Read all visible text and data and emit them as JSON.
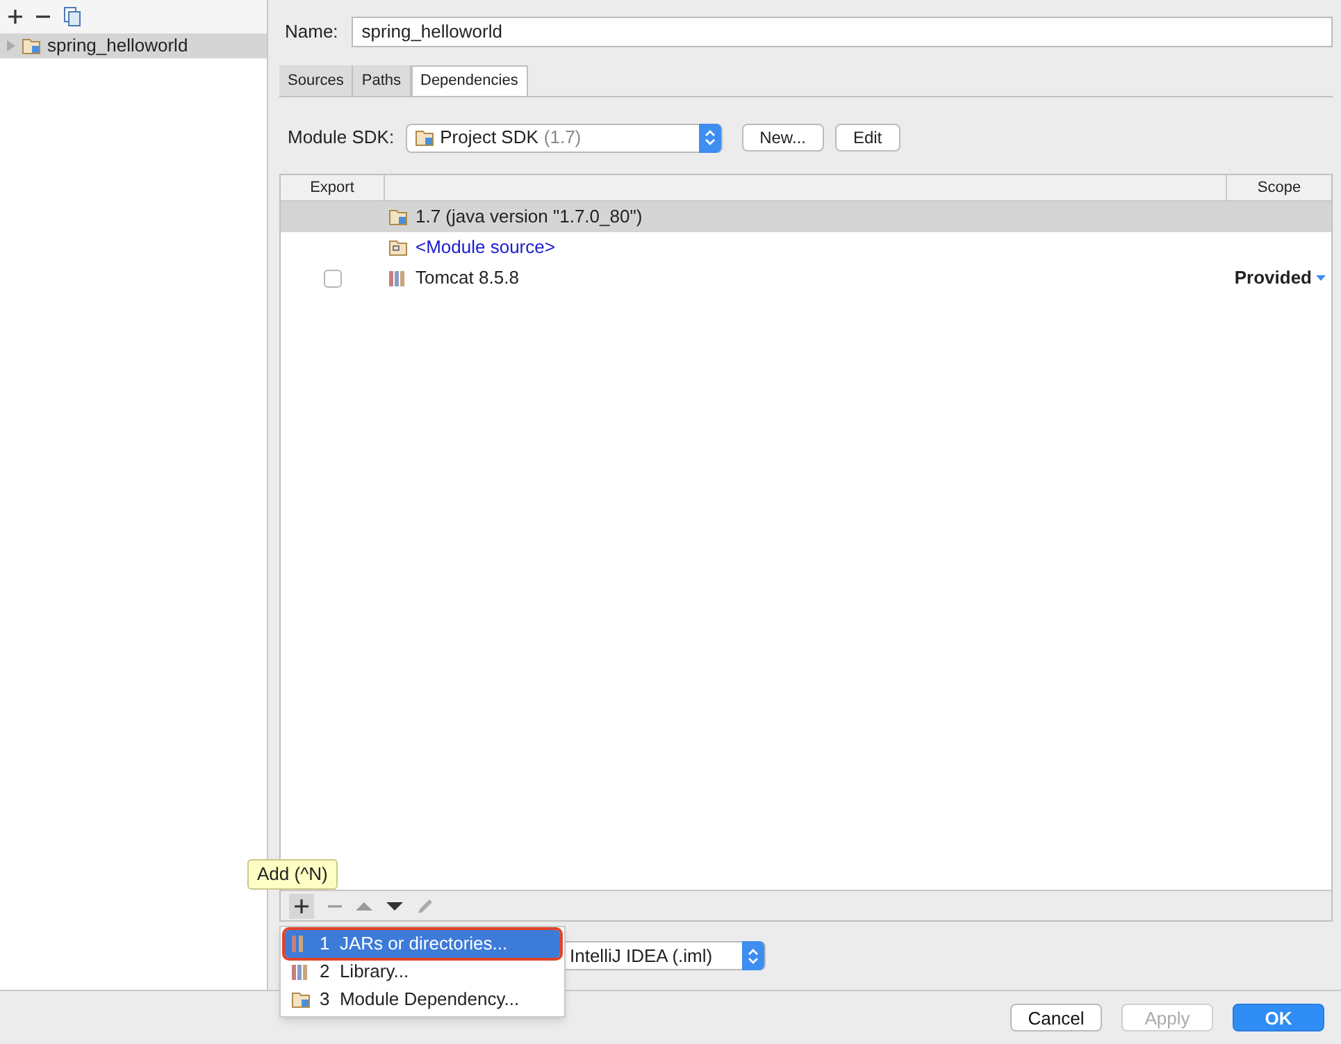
{
  "sidebar": {
    "tree": [
      {
        "label": "spring_helloworld",
        "selected": true,
        "expanded": false
      }
    ]
  },
  "name_field": {
    "label": "Name:",
    "value": "spring_helloworld"
  },
  "tabs": [
    {
      "label": "Sources",
      "selected": false
    },
    {
      "label": "Paths",
      "selected": false
    },
    {
      "label": "Dependencies",
      "selected": true
    }
  ],
  "module_sdk": {
    "label": "Module SDK:",
    "value": "Project SDK",
    "version": "(1.7)",
    "buttons": [
      "New...",
      "Edit"
    ]
  },
  "table": {
    "columns": [
      "Export",
      "Scope"
    ],
    "rows": [
      {
        "kind": "sdk",
        "label": "1.7 (java version \"1.7.0_80\")",
        "selected": true
      },
      {
        "kind": "source",
        "label": "<Module source>",
        "selected": false
      },
      {
        "kind": "library",
        "label": "Tomcat 8.5.8",
        "checked": false,
        "scope": "Provided",
        "selected": false
      }
    ]
  },
  "tooltip": "Add (^N)",
  "popup_menu": [
    {
      "kind": "jar",
      "number": "1",
      "label": "JARs or directories...",
      "selected": true
    },
    {
      "kind": "library",
      "number": "2",
      "label": "Library...",
      "selected": false
    },
    {
      "kind": "module",
      "number": "3",
      "label": "Module Dependency...",
      "selected": false
    }
  ],
  "storage_format": {
    "value": "IntelliJ IDEA (.iml)"
  },
  "buttons": [
    {
      "label": "Cancel",
      "kind": "normal"
    },
    {
      "label": "Apply",
      "kind": "disabled"
    },
    {
      "label": "OK",
      "kind": "default"
    }
  ]
}
